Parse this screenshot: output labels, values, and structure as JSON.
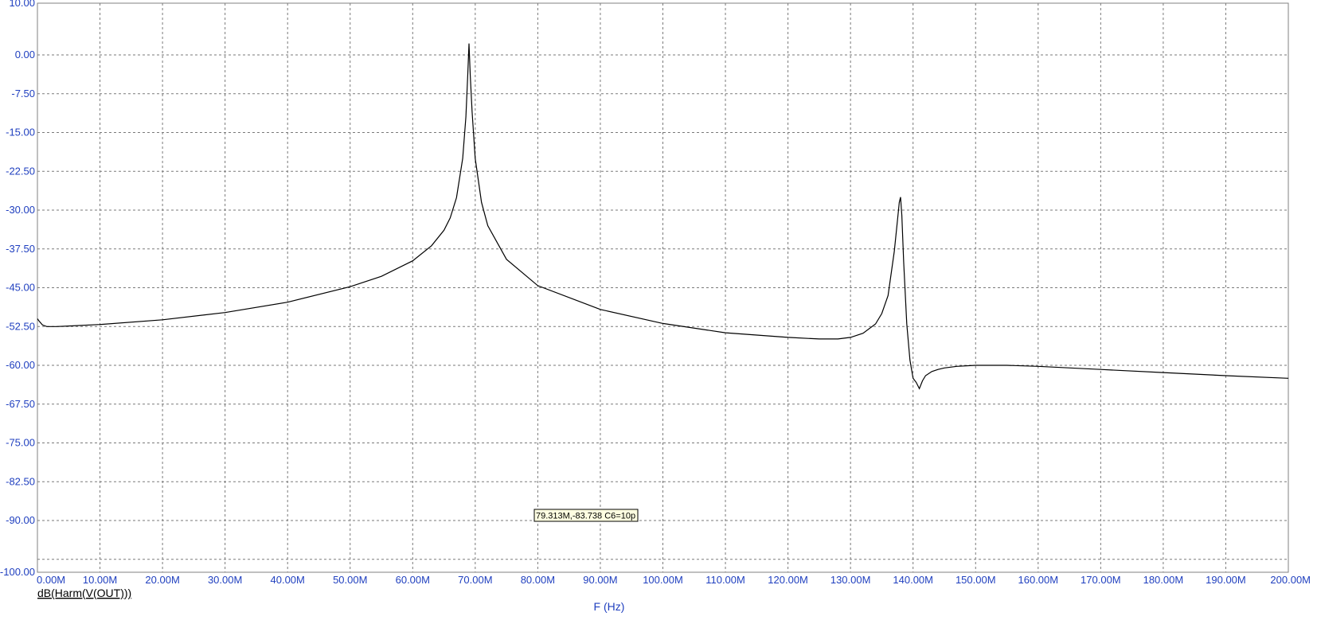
{
  "chart_data": {
    "type": "line",
    "title": "",
    "xlabel": "F (Hz)",
    "ylabel": "",
    "xlim": [
      0,
      200
    ],
    "ylim": [
      -100,
      10
    ],
    "grid": true,
    "legend": "bottom-left",
    "y_ticks": [
      "10.00",
      "0.00",
      "-7.50",
      "-15.00",
      "-22.50",
      "-30.00",
      "-37.50",
      "-45.00",
      "-52.50",
      "-60.00",
      "-67.50",
      "-75.00",
      "-82.50",
      "-90.00",
      "-100.00"
    ],
    "y_tick_values": [
      10,
      0,
      -7.5,
      -15,
      -22.5,
      -30,
      -37.5,
      -45,
      -52.5,
      -60,
      -67.5,
      -75,
      -82.5,
      -90,
      -100
    ],
    "x_ticks": [
      "0.00M",
      "10.00M",
      "20.00M",
      "30.00M",
      "40.00M",
      "50.00M",
      "60.00M",
      "70.00M",
      "80.00M",
      "90.00M",
      "100.00M",
      "110.00M",
      "120.00M",
      "130.00M",
      "140.00M",
      "150.00M",
      "160.00M",
      "170.00M",
      "180.00M",
      "190.00M",
      "200.00M"
    ],
    "x_tick_values": [
      0,
      10,
      20,
      30,
      40,
      50,
      60,
      70,
      80,
      90,
      100,
      110,
      120,
      130,
      140,
      150,
      160,
      170,
      180,
      190,
      200
    ],
    "series": [
      {
        "name": "dB(Harm(V(OUT)))",
        "color": "#000000",
        "x": [
          0,
          0.3,
          0.8,
          1.5,
          3,
          5,
          10,
          20,
          30,
          40,
          50,
          55,
          60,
          63,
          65,
          66,
          67,
          68,
          68.5,
          68.8,
          69.0,
          69.2,
          69.5,
          70,
          71,
          72,
          75,
          80,
          90,
          100,
          110,
          120,
          125,
          128,
          130,
          132,
          134,
          135,
          136,
          137,
          137.5,
          137.8,
          138.0,
          138.2,
          138.5,
          139,
          139.5,
          140,
          140.5,
          141,
          141.5,
          142,
          143,
          144,
          145,
          147,
          150,
          155,
          160,
          170,
          180,
          190,
          200
        ],
        "y": [
          -51,
          -51.5,
          -52.2,
          -52.5,
          -52.5,
          -52.4,
          -52.1,
          -51.2,
          -49.8,
          -47.8,
          -44.8,
          -42.8,
          -39.8,
          -36.9,
          -33.9,
          -31.5,
          -27.6,
          -20.0,
          -12.0,
          -4.0,
          2.2,
          -4.0,
          -11.0,
          -20.0,
          -28.5,
          -33.0,
          -39.5,
          -44.6,
          -49.2,
          -51.9,
          -53.7,
          -54.6,
          -54.9,
          -54.9,
          -54.6,
          -53.8,
          -52.0,
          -50.0,
          -46.5,
          -38.0,
          -32.0,
          -28.5,
          -27.5,
          -31.0,
          -40.0,
          -52.0,
          -59.0,
          -62.5,
          -63.3,
          -64.5,
          -63.0,
          -62.0,
          -61.2,
          -60.8,
          -60.5,
          -60.2,
          -60.0,
          -60.0,
          -60.2,
          -60.8,
          -61.4,
          -62.0,
          -62.5
        ]
      }
    ],
    "annotation": "79.313M,-83.738 C6=10p",
    "annotation_at": [
      79.313,
      -83.738
    ],
    "top_title_fragment": "...(...(....))  ....  ..  .."
  }
}
